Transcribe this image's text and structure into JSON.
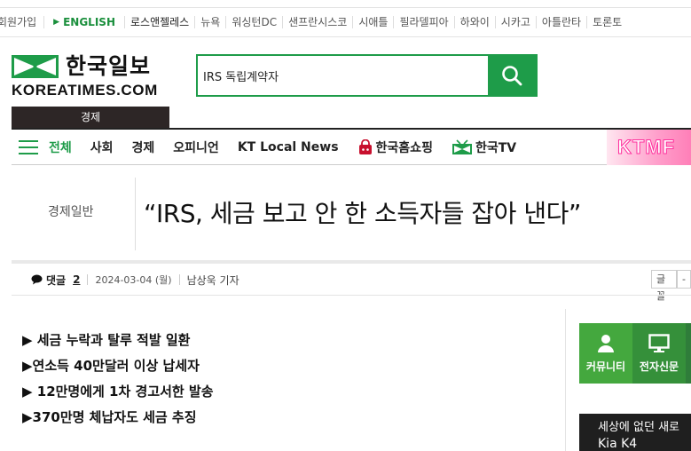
{
  "topbar": {
    "join": "회원가입",
    "english": "ENGLISH",
    "cities": [
      "로스앤젤레스",
      "뉴욕",
      "워싱턴DC",
      "샌프란시스코",
      "시애틀",
      "필라델피아",
      "하와이",
      "시카고",
      "아틀란타",
      "토론토"
    ]
  },
  "logo": {
    "ko": "한국일보",
    "en": "KOREATIMES.COM"
  },
  "section_tag": "경제",
  "search": {
    "value": "IRS 독립계약자"
  },
  "nav": {
    "items": [
      "전체",
      "사회",
      "경제",
      "오피니언",
      "KT Local News",
      "한국홈쇼핑",
      "한국TV"
    ],
    "banner": "KTMF"
  },
  "article": {
    "category": "경제일반",
    "headline": "“IRS, 세금 보고 안 한 소득자들 잡아 낸다”",
    "comments_label": "댓글",
    "comments_count": "2",
    "date": "2024-03-04 (월)",
    "author": "남상욱 기자",
    "summary": [
      "▶ 세금 누락과 탈루 적발 일환",
      "▶연소득 40만달러 이상 납세자",
      "▶ 12만명에게 1차 경고서한 발송",
      "▶370만명 체납자도 세금 추징"
    ]
  },
  "font_controls": {
    "label": "글꼴",
    "more": "-"
  },
  "sidebar": {
    "quick_links": [
      "커뮤니티",
      "전자신문"
    ],
    "promo_line1": "세상에 없던 새로",
    "promo_line2": "Kia K4"
  },
  "colors": {
    "brand_green": "#1e9c49",
    "dark": "#2d2626",
    "ktmf_pink": "#ff2d9b"
  }
}
